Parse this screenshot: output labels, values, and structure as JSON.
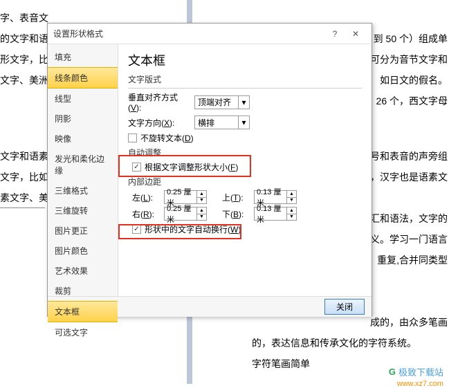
{
  "bg": {
    "l1": "字、表音文",
    "l2": "的文字和语",
    "l3": "形文字，比",
    "l4": "文字、美洲",
    "l5": "文字和语素",
    "l6": "文字，比如",
    "l7": "素文字、美",
    "r1": "到 50 个）组成单",
    "r2": "可分为音节文字和",
    "r3": "如日文的假名。",
    "r4": "26 个，西文字母",
    "r5": "号和表音的声旁组",
    "r6": "，汉字也是语素文",
    "r7": "汇和语法，文字的",
    "r8": "义。学习一门语言",
    "r9": "重复,合并同类型",
    "b1": "成的，由众多笔画",
    "b2": "的，表达信息和传承文化的字符系统。",
    "b3": "字符笔画简单"
  },
  "dialog": {
    "title": "设置形状格式",
    "sidebar": [
      "填充",
      "线条颜色",
      "线型",
      "阴影",
      "映像",
      "发光和柔化边缘",
      "三维格式",
      "三维旋转",
      "图片更正",
      "图片颜色",
      "艺术效果",
      "裁剪",
      "文本框",
      "可选文字"
    ],
    "main": {
      "heading": "文本框",
      "sec1": "文字版式",
      "valign_label_pre": "垂直对齐方式(",
      "valign_key": "V",
      "valign_label_post": "):",
      "valign_value": "顶端对齐",
      "dir_label_pre": "文字方向(",
      "dir_key": "X",
      "dir_label_post": "):",
      "dir_value": "横排",
      "norotate_pre": "不旋转文本(",
      "norotate_key": "D",
      "norotate_post": ")",
      "autosize_section": "自动调整",
      "autosize_pre": "根据文字调整形状大小(",
      "autosize_key": "F",
      "autosize_post": ")",
      "margin_section": "内部边距",
      "left_pre": "左(",
      "left_key": "L",
      "left_post": "):",
      "right_pre": "右(",
      "right_key": "R",
      "right_post": "):",
      "top_pre": "上(",
      "top_key": "T",
      "top_post": "):",
      "bottom_pre": "下(",
      "bottom_key": "B",
      "bottom_post": "):",
      "left_val": "0.25 厘米",
      "right_val": "0.25 厘米",
      "top_val": "0.13 厘米",
      "bottom_val": "0.13 厘米",
      "wrap_pre": "形状中的文字自动换行(",
      "wrap_key": "W",
      "wrap_post": ")"
    },
    "close": "关闭"
  },
  "watermark": {
    "logo": "G",
    "name": "极致下载站",
    "url": "www.xz7.com"
  }
}
